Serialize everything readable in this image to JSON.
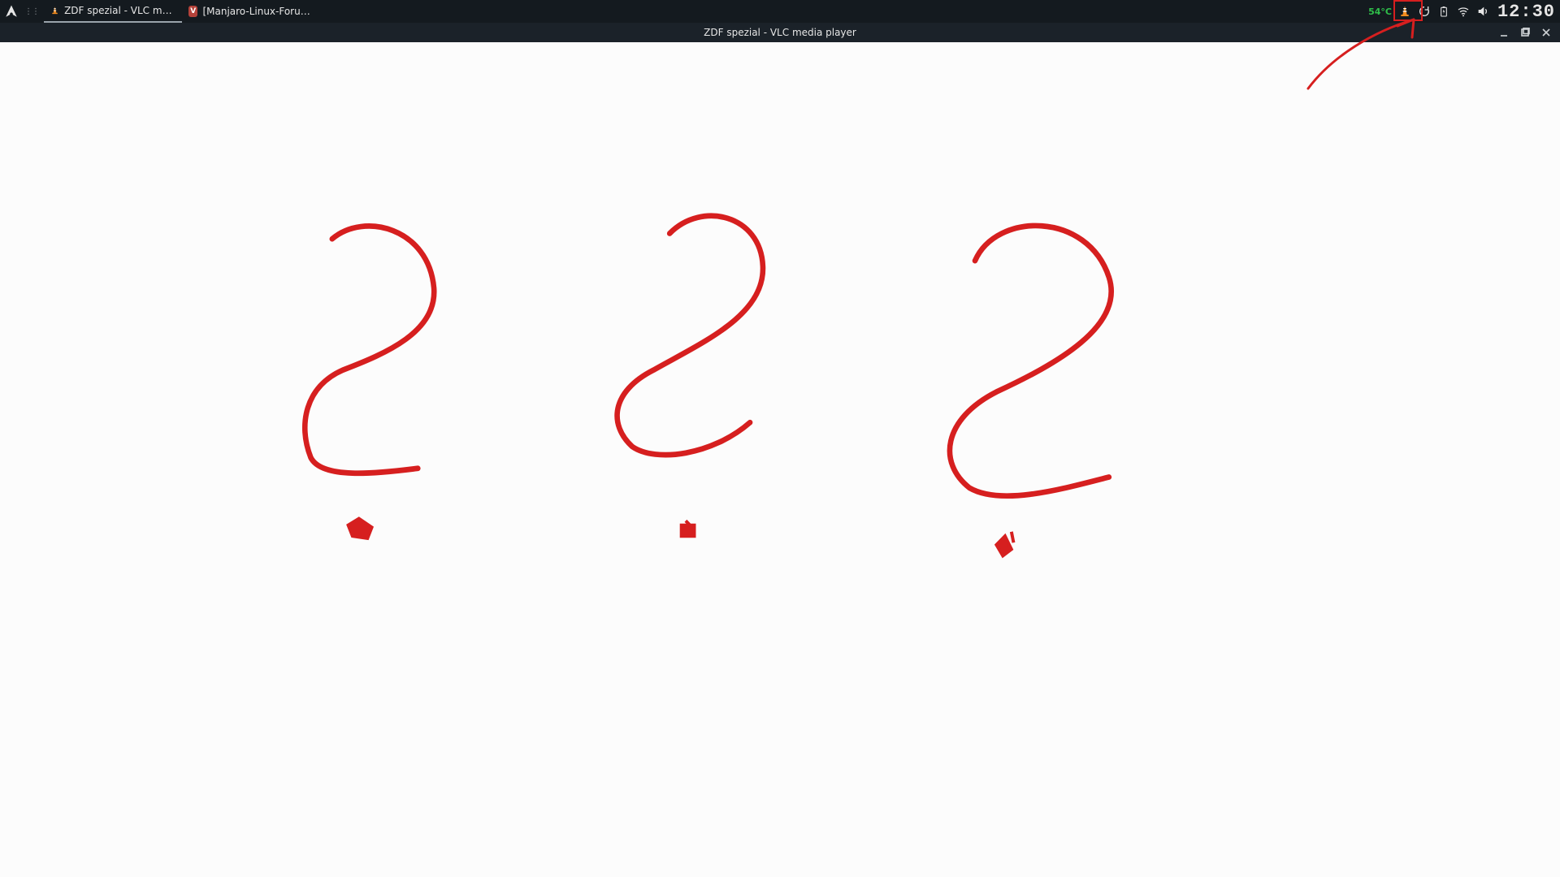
{
  "taskbar": {
    "tasks": [
      {
        "label": "ZDF spezial - VLC media pl…",
        "icon": "vlc",
        "active": true
      },
      {
        "label": "[Manjaro-Linux-Forum - Ei…",
        "icon": "browser",
        "active": false
      }
    ],
    "tray": {
      "temperature": "54°C",
      "clock": "12:30"
    }
  },
  "vlc": {
    "title": "ZDF spezial - VLC media player"
  },
  "annotation": {
    "color": "#d61f1f"
  }
}
